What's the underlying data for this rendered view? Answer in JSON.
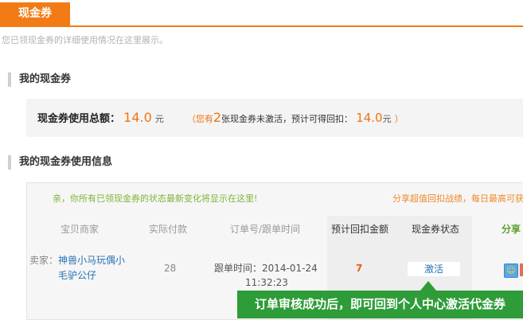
{
  "tab": {
    "label": "现金券"
  },
  "description": "您已领现金券的详细使用情况在这里展示。",
  "section_my_coupons": {
    "title": "我的现金券"
  },
  "summary": {
    "label": "现金券使用总额：",
    "amount": "14.0",
    "unit": "元",
    "paren_open": "（您有",
    "count": "2",
    "middle": "张现金券未激活，预计可得回扣：",
    "expected": "14.0",
    "unit2": "元",
    "paren_close": "）"
  },
  "section_usage": {
    "title": "我的现金券使用信息"
  },
  "notice": {
    "left": "亲，你所有已领现金券的状态最新变化将显示在这里!",
    "right": "分享超值回扣战绩，每日最高可获"
  },
  "table": {
    "headers": [
      "宝贝商家",
      "实际付款",
      "订单号/跟单时间",
      "预计回扣金额",
      "现金券状态",
      "分享"
    ],
    "row": {
      "seller_prefix": "卖家：",
      "seller_name_1": "神兽小马玩偶小",
      "seller_name_2": "毛驴公仔",
      "payment": "28",
      "order_time_label": "跟单时间：2014-01-24",
      "order_time_2": "11:32:23",
      "rebate": "7",
      "status_button": "激活",
      "share_icon": "smile-icon"
    }
  },
  "tooltip": {
    "text": "订单审核成功后，即可回到个人中心激活代金券"
  },
  "colors": {
    "accent": "#f27b16",
    "tooltip": "#2e9c38",
    "link": "#2a73b5"
  }
}
